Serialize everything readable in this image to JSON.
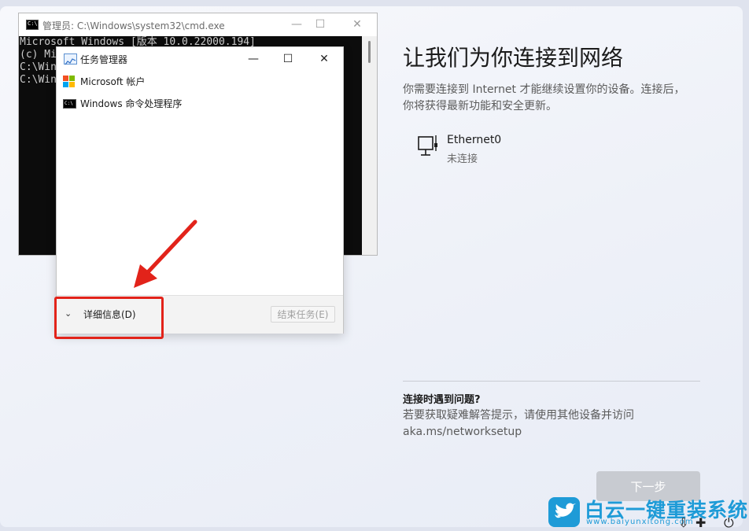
{
  "oobe": {
    "title": "让我们为你连接到网络",
    "description": "你需要连接到 Internet 才能继续设置你的设备。连接后，你将获得最新功能和安全更新。",
    "network": {
      "name": "Ethernet0",
      "status": "未连接"
    },
    "help_title": "连接时遇到问题?",
    "help_text": "若要获取疑难解答提示，请使用其他设备并访问 aka.ms/networksetup",
    "next_label": "下一步"
  },
  "cmd": {
    "title": "管理员: C:\\Windows\\system32\\cmd.exe",
    "icon_text": "C:\\",
    "lines": [
      "Microsoft Windows [版本 10.0.22000.194]",
      "(c) Mi",
      "",
      "C:\\Win",
      "",
      "C:\\Win"
    ],
    "controls": {
      "minimize": "—",
      "maximize": "☐",
      "close": "✕"
    }
  },
  "task_manager": {
    "title": "任务管理器",
    "processes": [
      {
        "label": "Microsoft 帐户",
        "icon": "microsoft-logo-icon"
      },
      {
        "label": "Windows 命令处理程序",
        "icon": "cmd-icon"
      }
    ],
    "details_label": "详细信息(D)",
    "end_task_label": "结束任务(E)",
    "controls": {
      "minimize": "—",
      "maximize": "☐",
      "close": "✕"
    }
  },
  "watermark": {
    "brand": "白云一键重装系统",
    "url": "www.baiyunxitong.com"
  },
  "colors": {
    "annotation_red": "#e2231a",
    "watermark_blue": "#1e9bd7",
    "button_disabled": "#c8cbd1"
  }
}
